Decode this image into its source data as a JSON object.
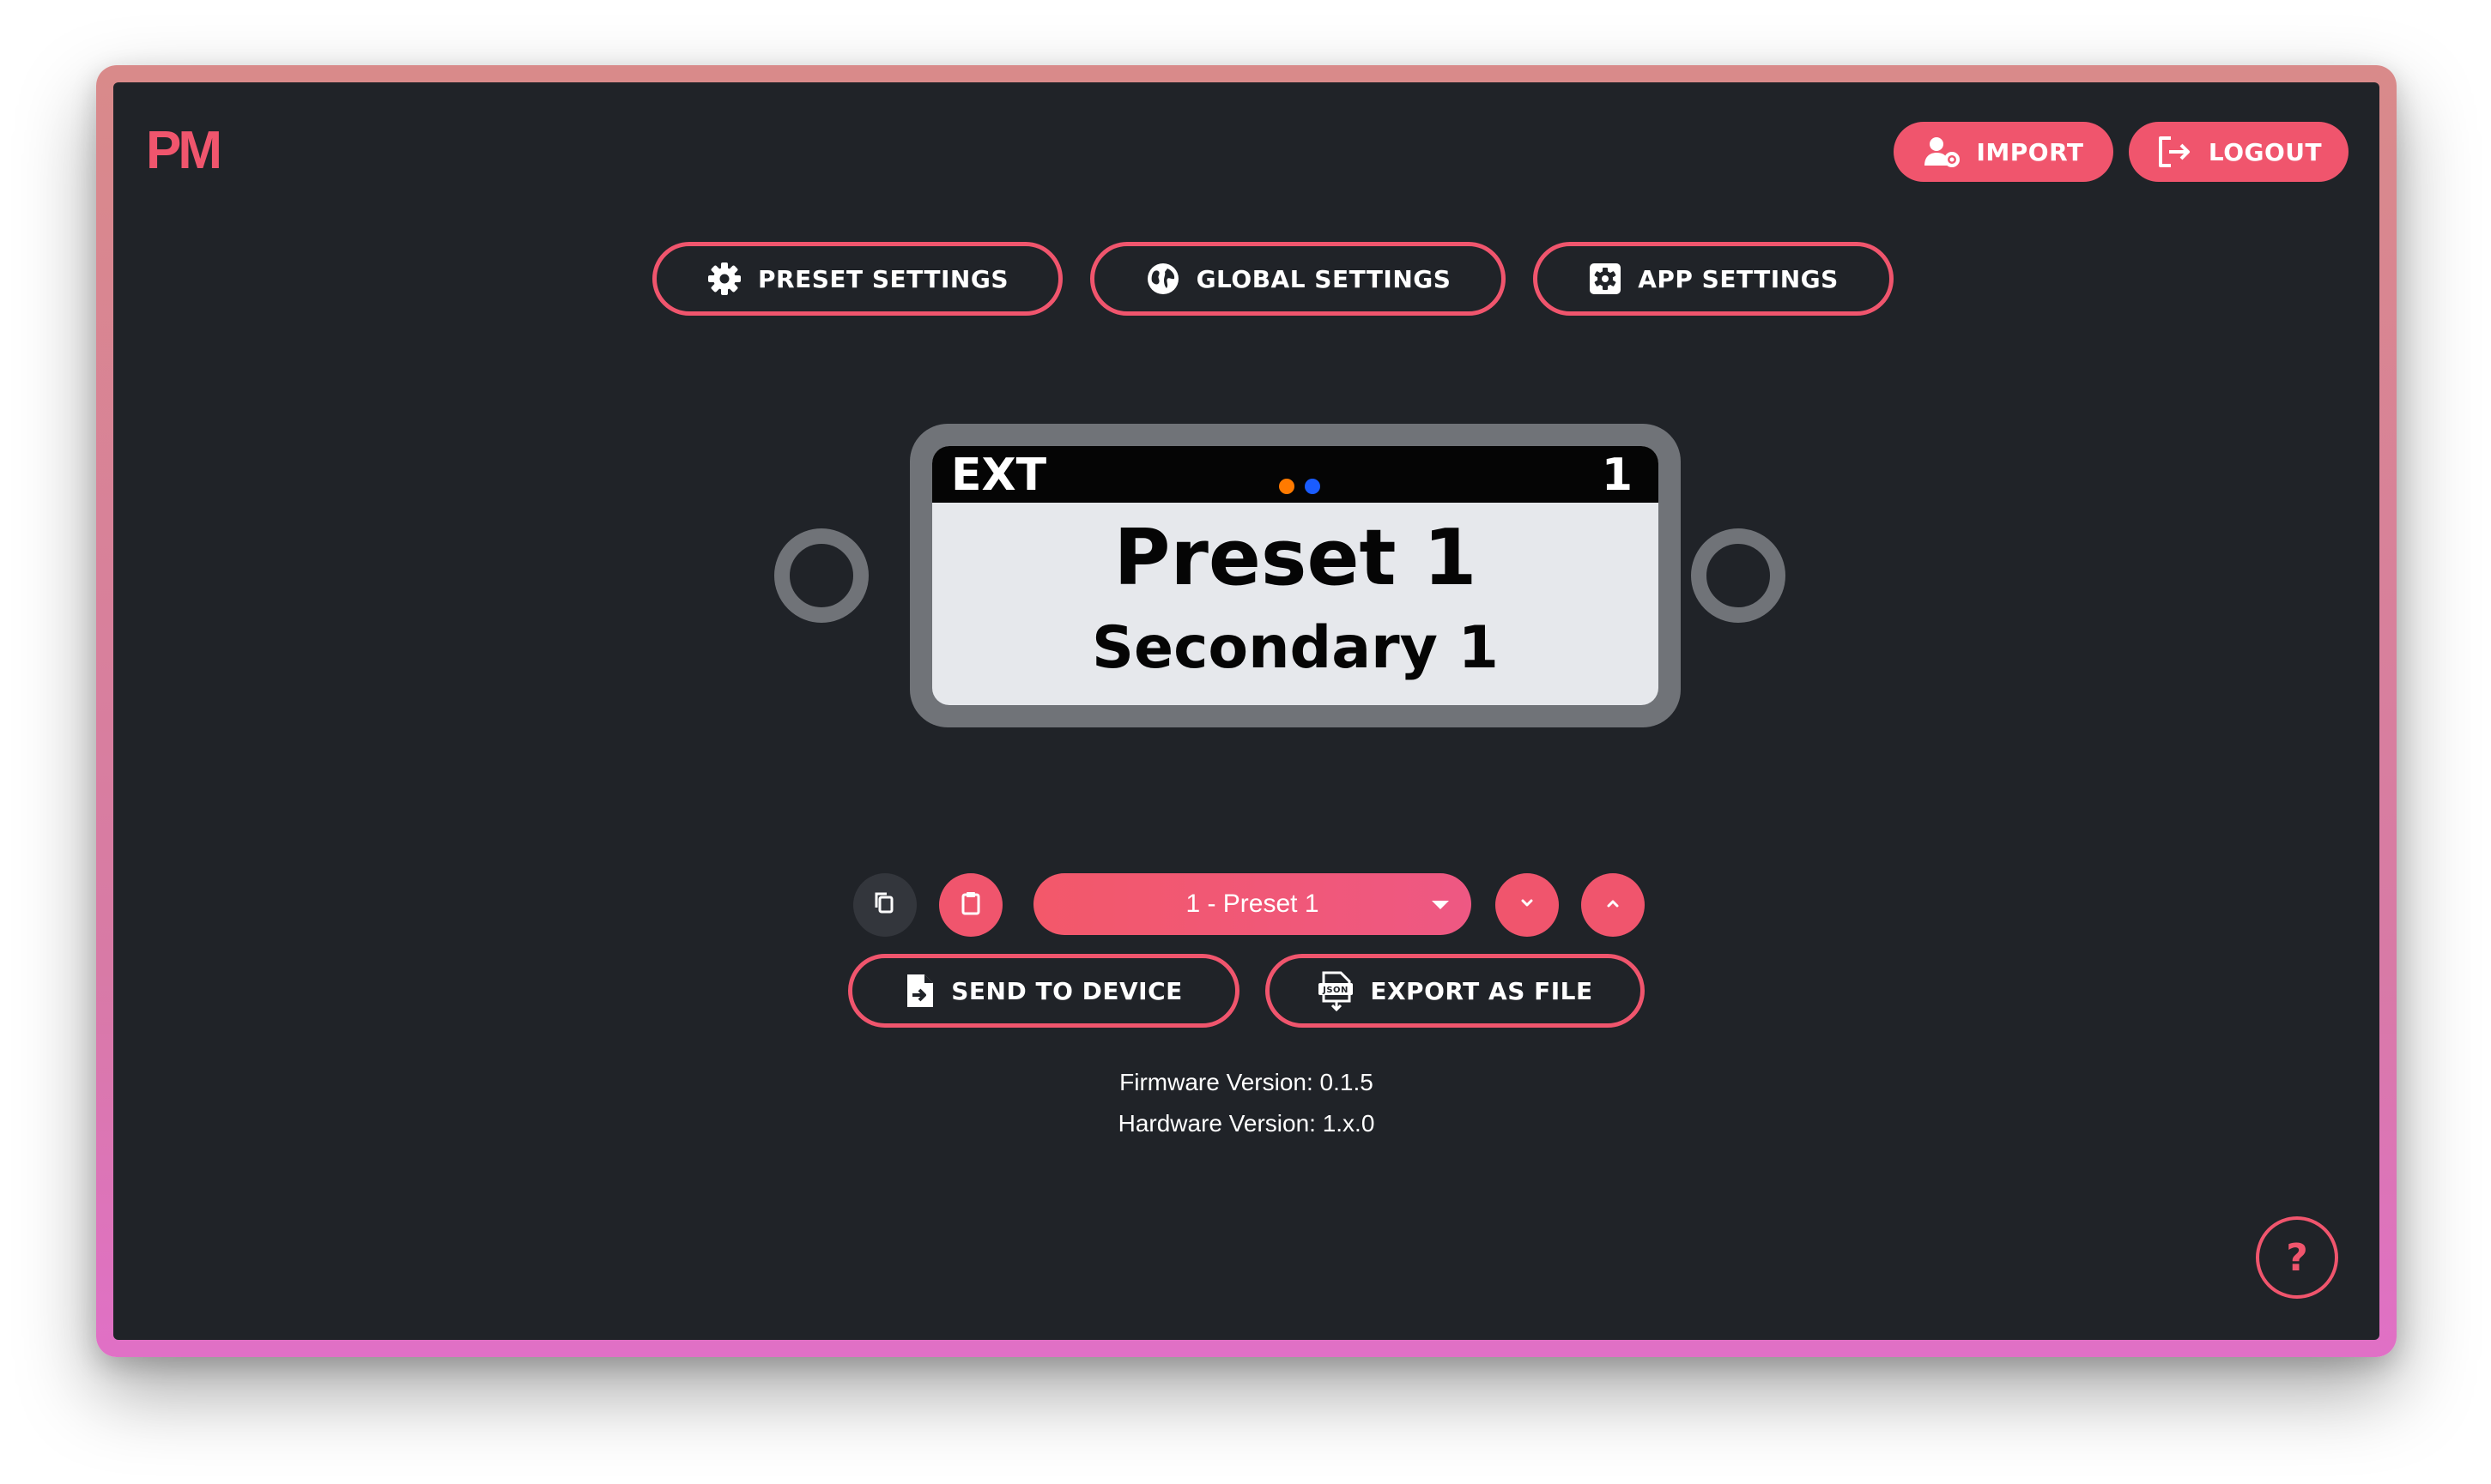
{
  "app": {
    "logo_text": "PM",
    "accent_color": "#f0556d",
    "background_color": "#202328"
  },
  "header": {
    "import_label": "IMPORT",
    "logout_label": "LOGOUT"
  },
  "settings_nav": {
    "preset_settings_label": "PRESET SETTINGS",
    "global_settings_label": "GLOBAL SETTINGS",
    "app_settings_label": "APP SETTINGS"
  },
  "display": {
    "mode_text": "EXT",
    "bank_number": "1",
    "indicator_colors": [
      "#ff7a00",
      "#1a5cff"
    ],
    "preset_name": "Preset 1",
    "secondary_name": "Secondary 1"
  },
  "preset_controls": {
    "selected_preset": "1 - Preset 1",
    "copy_icon": "copy-icon",
    "paste_icon": "clipboard-icon",
    "down_icon": "chevron-down-icon",
    "up_icon": "chevron-up-icon"
  },
  "actions": {
    "send_to_device_label": "SEND TO DEVICE",
    "export_as_file_label": "EXPORT AS FILE"
  },
  "device_info": {
    "firmware_version": "Firmware Version: 0.1.5",
    "hardware_version": "Hardware Version: 1.x.0"
  },
  "help": {
    "label": "?"
  }
}
